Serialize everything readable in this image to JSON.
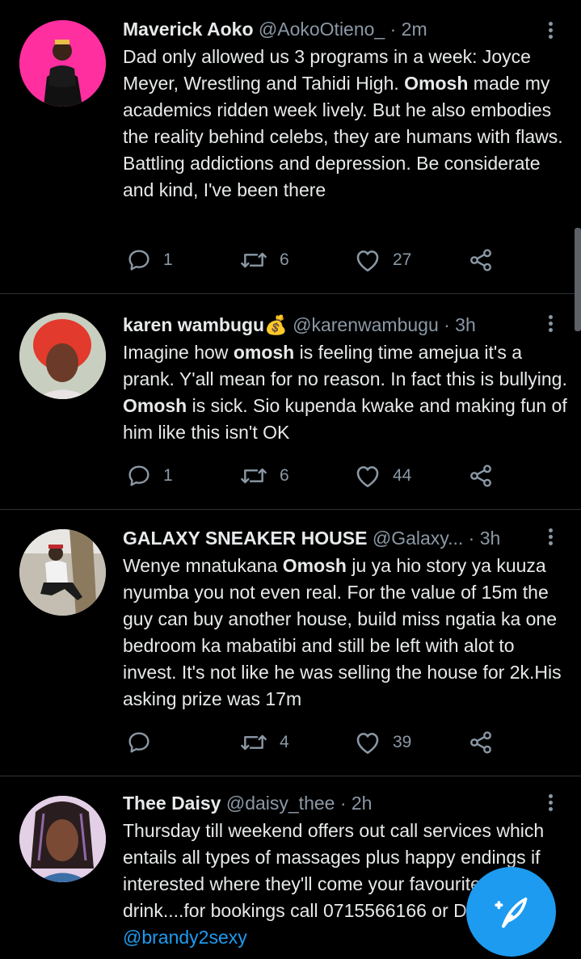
{
  "colors": {
    "background": "#000000",
    "text": "#e7e9ea",
    "muted": "#8b98a5",
    "accent": "#1d9bf0",
    "divider": "#2f3336"
  },
  "tweets": [
    {
      "name": "Maverick Aoko",
      "handle": "@AokoOtieno_",
      "time": "· 2m",
      "text": [
        "Dad only allowed us 3 programs in a week: Joyce Meyer, Wrestling and Tahidi High. ",
        "Omosh",
        " made my academics ridden week lively. But he also embodies the reality behind celebs, they are humans with flaws. Battling addictions and depression. Be considerate and kind, I've been there"
      ],
      "replies": "1",
      "retweets": "6",
      "likes": "27",
      "avatar": "person-on-pink-background"
    },
    {
      "name": "karen wambugu💰",
      "handle": "@karenwambugu",
      "time": "· 3h",
      "text": [
        "Imagine how ",
        "omosh",
        " is feeling time amejua it's a prank. Y'all mean for no reason. In fact this is bullying. ",
        "Omosh",
        " is sick. Sio kupenda kwake and making fun of him like this isn't OK"
      ],
      "replies": "1",
      "retweets": "6",
      "likes": "44",
      "avatar": "person-with-red-hair"
    },
    {
      "name": "GALAXY SNEAKER HOUSE",
      "handle": "@Galaxy...",
      "time": "· 3h",
      "text": [
        "Wenye mnatukana ",
        "Omosh",
        " ju ya hio story ya kuuza nyumba you not even real. For the value of 15m the guy can buy another house, build miss ngatia ka one bedroom ka mabatibi and still be left with alot to invest. It's not like he was selling the house for 2k.His asking prize was 17m"
      ],
      "replies": "",
      "retweets": "4",
      "likes": "39",
      "avatar": "person-sitting-outdoors"
    },
    {
      "name": "Thee Daisy",
      "handle": "@daisy_thee",
      "time": "· 2h",
      "text": [
        "Thursday till weekend offers out call services which entails all types of massages plus happy endings if interested where they'll come your favourite drink....for bookings call 0715566166 or DM ",
        "@brandy2sexy"
      ],
      "avatar": "person-with-braids"
    }
  ]
}
